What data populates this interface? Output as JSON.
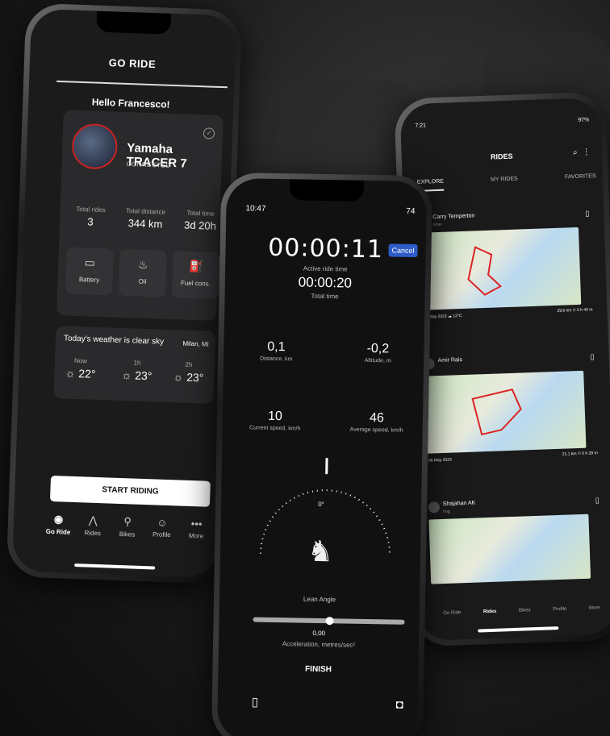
{
  "go_ride": {
    "title": "GO RIDE",
    "greeting": "Hello Francesco!",
    "bike": {
      "name": "Yamaha TRACER 7",
      "status": "CONNECTED"
    },
    "stats": [
      {
        "label": "Total rides",
        "value": "3"
      },
      {
        "label": "Total distance",
        "value": "344 km"
      },
      {
        "label": "Total time",
        "value": "3d 20h"
      }
    ],
    "tiles": [
      {
        "label": "Battery",
        "icon": "battery-icon"
      },
      {
        "label": "Oil",
        "icon": "oil-icon"
      },
      {
        "label": "Fuel cons.",
        "icon": "fuel-icon"
      }
    ],
    "weather": {
      "title": "Today's weather is clear sky",
      "location": "Milan, MI",
      "forecast": [
        {
          "time": "Now",
          "temp": "22°"
        },
        {
          "time": "1h",
          "temp": "23°"
        },
        {
          "time": "2h",
          "temp": "23°"
        }
      ]
    },
    "start_label": "START RIDING",
    "tabs": [
      {
        "label": "Go Ride",
        "icon": "go-ride-icon"
      },
      {
        "label": "Rides",
        "icon": "rides-icon"
      },
      {
        "label": "Bikes",
        "icon": "bikes-icon"
      },
      {
        "label": "Profile",
        "icon": "profile-icon"
      },
      {
        "label": "More",
        "icon": "more-icon"
      }
    ]
  },
  "ride_tracking": {
    "clock": "10:47",
    "battery": "74",
    "elapsed": "00:00:11",
    "cancel_label": "Cancel",
    "active_label": "Active ride time",
    "total_time": "00:00:20",
    "total_label": "Total time",
    "distance": {
      "value": "0,1",
      "label": "Distance, km"
    },
    "altitude": {
      "value": "-0,2",
      "label": "Altitude, m"
    },
    "current_speed": {
      "value": "10",
      "label": "Current speed, km/h"
    },
    "average_speed": {
      "value": "46",
      "label": "Average speed, km/h"
    },
    "lean_degrees": "0°",
    "lean_label": "Lean Angle",
    "acceleration_value": "0,00",
    "acceleration_label": "Acceleration, metres/sec²",
    "finish_label": "FINISH"
  },
  "rides": {
    "clock": "7:21",
    "battery": "97%",
    "title": "RIDES",
    "tabs": [
      "EXPLORE",
      "MY RIDES",
      "FAVORITES"
    ],
    "items": [
      {
        "user": "Carry Temperton",
        "sub": "other",
        "date": "06 May 2023",
        "weather": "12°C",
        "distance": "29.6 km",
        "duration": "0 h 40 m"
      },
      {
        "user": "Amir Rais",
        "sub": "",
        "date": "06 May 2023",
        "weather": "",
        "distance": "21.1 km",
        "duration": "0 h 29 m"
      },
      {
        "user": "Shajahan AK",
        "sub": "hog",
        "date": "",
        "weather": "",
        "distance": "",
        "duration": ""
      }
    ],
    "bottom_tabs": [
      "Go Ride",
      "Rides",
      "Bikes",
      "Profile",
      "More"
    ]
  },
  "colors": {
    "accent_blue": "#2e5cc8",
    "ring_red": "#cc2222"
  }
}
